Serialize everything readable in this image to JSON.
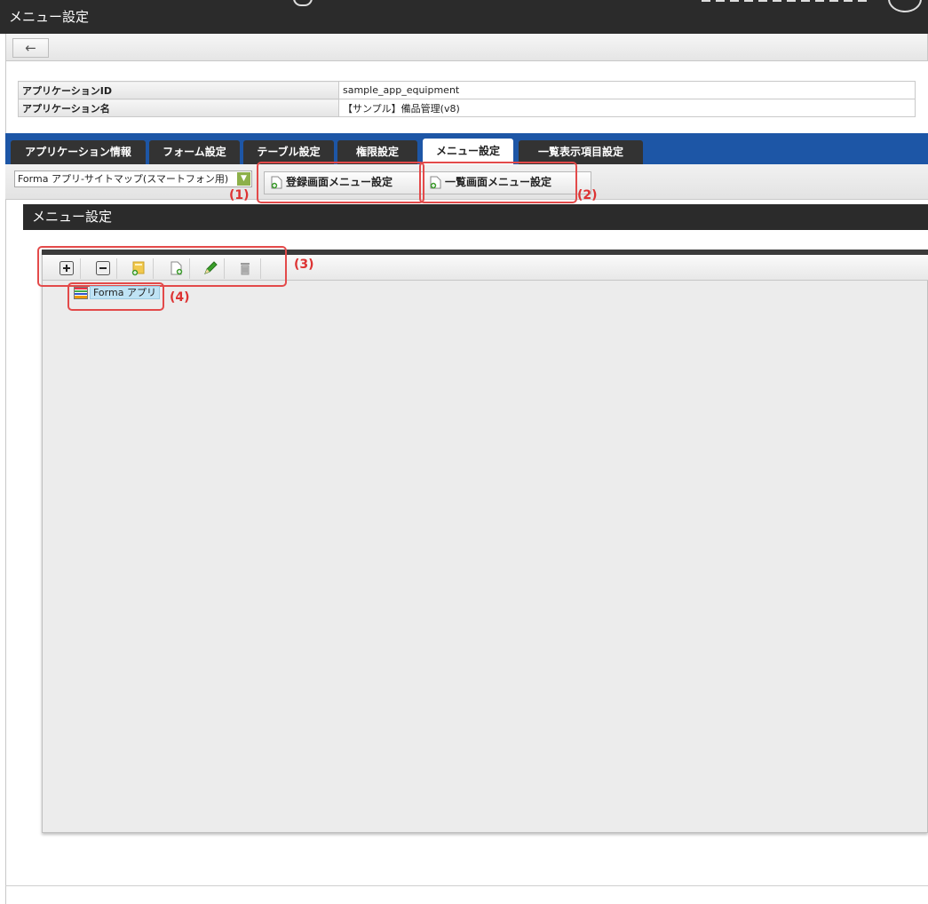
{
  "window": {
    "title": "メニュー設定"
  },
  "toolbar": {
    "back_icon": "←"
  },
  "app_info": {
    "rows": [
      {
        "key": "アプリケーションID",
        "value": "sample_app_equipment"
      },
      {
        "key": "アプリケーション名",
        "value": "【サンプル】備品管理(v8)"
      }
    ]
  },
  "tabs": [
    {
      "label": "アプリケーション情報",
      "active": false
    },
    {
      "label": "フォーム設定",
      "active": false
    },
    {
      "label": "テーブル設定",
      "active": false
    },
    {
      "label": "権限設定",
      "active": false
    },
    {
      "label": "メニュー設定",
      "active": true
    },
    {
      "label": "一覧表示項目設定",
      "active": false
    }
  ],
  "subbar": {
    "sitemap_select": "Forma アプリ-サイトマップ(スマートフォン用)",
    "register_menu_button": "登録画面メニュー設定",
    "list_menu_button": "一覧画面メニュー設定"
  },
  "annotations": {
    "a1": "(1)",
    "a2": "(2)",
    "a3": "(3)",
    "a4": "(4)"
  },
  "section": {
    "title": "メニュー設定"
  },
  "tree": {
    "toolbar_icons": [
      "expand-icon",
      "collapse-icon",
      "add-folder-icon",
      "add-page-icon",
      "edit-icon",
      "delete-icon"
    ],
    "nodes": [
      {
        "label": "Forma アプリ"
      }
    ]
  },
  "colors": {
    "tab_bar": "#1d56a6",
    "header_dark": "#2b2b2b",
    "highlight": "#e34a4a",
    "tree_selected": "#bfe3f5"
  }
}
